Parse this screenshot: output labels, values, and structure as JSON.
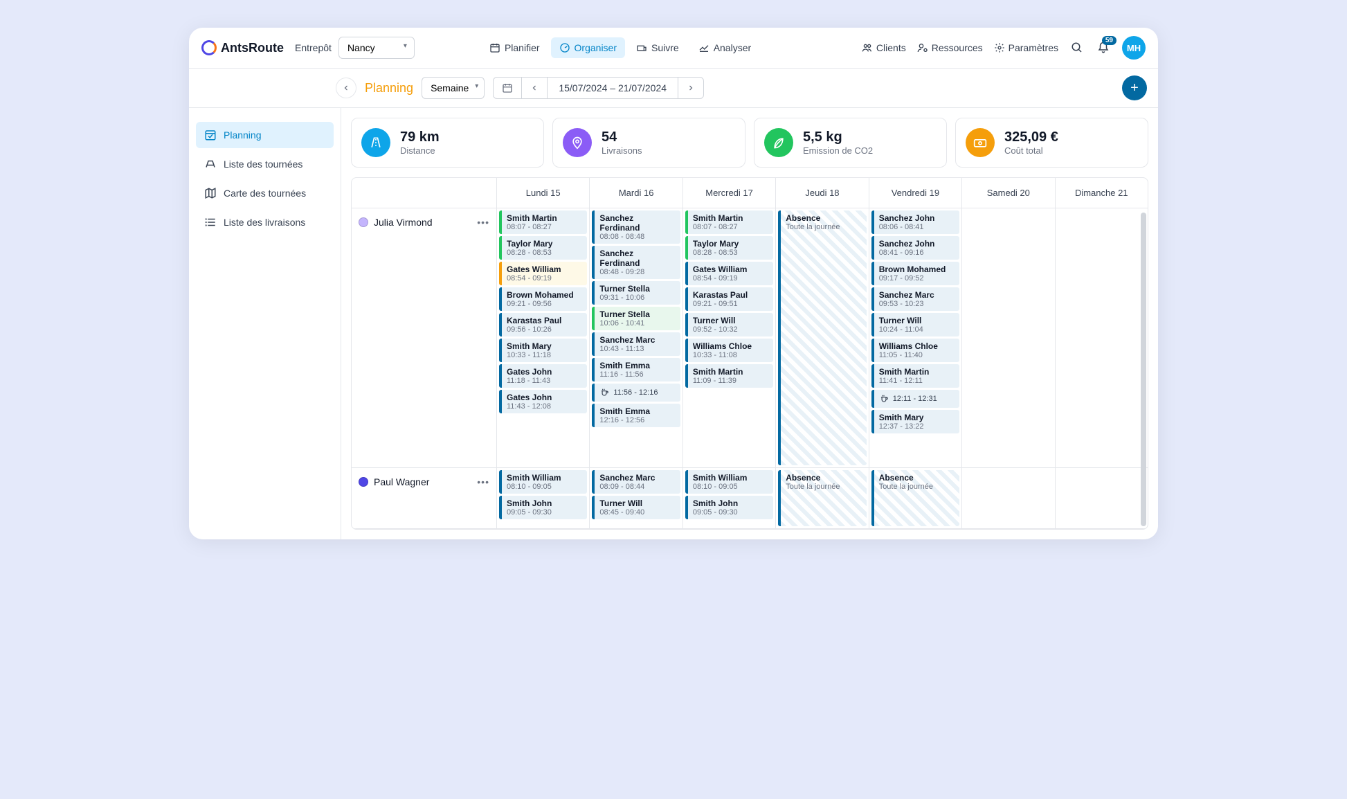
{
  "brand": "AntsRoute",
  "entrepot": {
    "label": "Entrepôt",
    "value": "Nancy"
  },
  "topnav": [
    {
      "label": "Planifier",
      "icon": "calendar-icon"
    },
    {
      "label": "Organiser",
      "icon": "gauge-icon",
      "active": true
    },
    {
      "label": "Suivre",
      "icon": "track-icon"
    },
    {
      "label": "Analyser",
      "icon": "chart-icon"
    }
  ],
  "rightnav": [
    {
      "label": "Clients",
      "icon": "users-icon"
    },
    {
      "label": "Ressources",
      "icon": "user-gear-icon"
    },
    {
      "label": "Paramètres",
      "icon": "gear-icon"
    }
  ],
  "notifications": "59",
  "avatar": "MH",
  "page_title": "Planning",
  "view_range": "Semaine",
  "date_range": "15/07/2024 – 21/07/2024",
  "sidebar": [
    {
      "label": "Planning",
      "active": true
    },
    {
      "label": "Liste des tournées"
    },
    {
      "label": "Carte des tournées"
    },
    {
      "label": "Liste des livraisons"
    }
  ],
  "stats": [
    {
      "value": "79 km",
      "label": "Distance",
      "color": "#0ea5e9",
      "icon": "road-icon"
    },
    {
      "value": "54",
      "label": "Livraisons",
      "color": "#8b5cf6",
      "icon": "pin-icon"
    },
    {
      "value": "5,5 kg",
      "label": "Emission de CO2",
      "color": "#22c55e",
      "icon": "leaf-icon"
    },
    {
      "value": "325,09 €",
      "label": "Coût total",
      "color": "#f59e0b",
      "icon": "money-icon"
    }
  ],
  "days": [
    "Lundi 15",
    "Mardi 16",
    "Mercredi 17",
    "Jeudi 18",
    "Vendredi 19",
    "Samedi 20",
    "Dimanche 21"
  ],
  "agents": [
    {
      "name": "Julia Virmond",
      "dot_color": "#c4b5fd",
      "columns": [
        [
          {
            "name": "Smith Martin",
            "time": "08:07 - 08:27",
            "style": "green"
          },
          {
            "name": "Taylor Mary",
            "time": "08:28 - 08:53",
            "style": "green"
          },
          {
            "name": "Gates William",
            "time": "08:54 - 09:19",
            "style": "yellow"
          },
          {
            "name": "Brown Mohamed",
            "time": "09:21 - 09:56"
          },
          {
            "name": "Karastas Paul",
            "time": "09:56 - 10:26"
          },
          {
            "name": "Smith Mary",
            "time": "10:33 - 11:18"
          },
          {
            "name": "Gates John",
            "time": "11:18 - 11:43"
          },
          {
            "name": "Gates John",
            "time": "11:43 - 12:08"
          }
        ],
        [
          {
            "name": "Sanchez Ferdinand",
            "time": "08:08 - 08:48"
          },
          {
            "name": "Sanchez Ferdinand",
            "time": "08:48 - 09:28"
          },
          {
            "name": "Turner Stella",
            "time": "09:31 - 10:06"
          },
          {
            "name": "Turner Stella",
            "time": "10:06 - 10:41",
            "style": "greenbg"
          },
          {
            "name": "Sanchez Marc",
            "time": "10:43 - 11:13"
          },
          {
            "name": "Smith Emma",
            "time": "11:16 - 11:56"
          },
          {
            "type": "break",
            "time": "11:56 - 12:16"
          },
          {
            "name": "Smith Emma",
            "time": "12:16 - 12:56"
          }
        ],
        [
          {
            "name": "Smith Martin",
            "time": "08:07 - 08:27",
            "style": "green"
          },
          {
            "name": "Taylor Mary",
            "time": "08:28 - 08:53",
            "style": "green"
          },
          {
            "name": "Gates William",
            "time": "08:54 - 09:19"
          },
          {
            "name": "Karastas Paul",
            "time": "09:21 - 09:51"
          },
          {
            "name": "Turner Will",
            "time": "09:52 - 10:32"
          },
          {
            "name": "Williams Chloe",
            "time": "10:33 - 11:08"
          },
          {
            "name": "Smith Martin",
            "time": "11:09 - 11:39"
          }
        ],
        [
          {
            "type": "absence",
            "name": "Absence",
            "time": "Toute la journée"
          }
        ],
        [
          {
            "name": "Sanchez John",
            "time": "08:06 - 08:41"
          },
          {
            "name": "Sanchez John",
            "time": "08:41 - 09:16"
          },
          {
            "name": "Brown Mohamed",
            "time": "09:17 - 09:52"
          },
          {
            "name": "Sanchez Marc",
            "time": "09:53 - 10:23"
          },
          {
            "name": "Turner Will",
            "time": "10:24 - 11:04"
          },
          {
            "name": "Williams Chloe",
            "time": "11:05 - 11:40"
          },
          {
            "name": "Smith Martin",
            "time": "11:41 - 12:11"
          },
          {
            "type": "break",
            "time": "12:11 - 12:31"
          },
          {
            "name": "Smith Mary",
            "time": "12:37 - 13:22"
          }
        ],
        [],
        []
      ]
    },
    {
      "name": "Paul Wagner",
      "dot_color": "#4f46e5",
      "columns": [
        [
          {
            "name": "Smith William",
            "time": "08:10 - 09:05"
          },
          {
            "name": "Smith John",
            "time": "09:05 - 09:30"
          }
        ],
        [
          {
            "name": "Sanchez Marc",
            "time": "08:09 - 08:44"
          },
          {
            "name": "Turner Will",
            "time": "08:45 - 09:40"
          }
        ],
        [
          {
            "name": "Smith William",
            "time": "08:10 - 09:05"
          },
          {
            "name": "Smith John",
            "time": "09:05 - 09:30"
          }
        ],
        [
          {
            "type": "absence",
            "name": "Absence",
            "time": "Toute la journée"
          }
        ],
        [
          {
            "type": "absence",
            "name": "Absence",
            "time": "Toute la journée"
          }
        ],
        [],
        []
      ]
    }
  ]
}
